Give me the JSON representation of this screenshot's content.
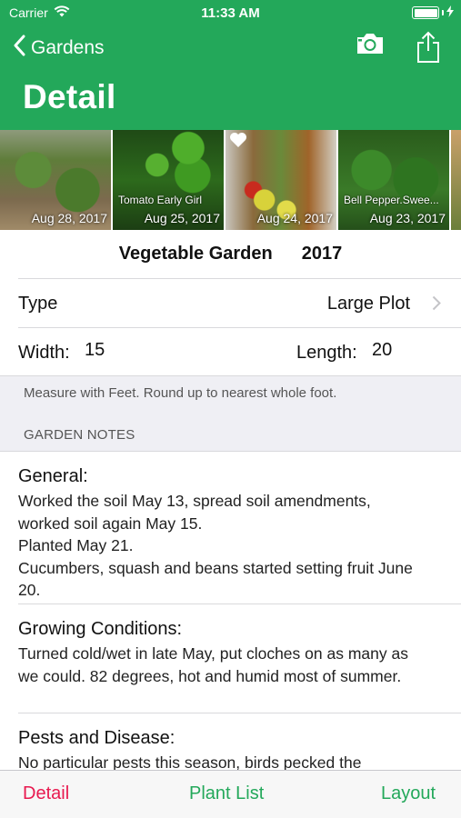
{
  "status": {
    "carrier": "Carrier",
    "time": "11:33 AM"
  },
  "nav": {
    "back_label": "Gardens",
    "title": "Detail",
    "camera_icon": "camera-icon",
    "share_icon": "share-icon"
  },
  "photos": [
    {
      "caption": "",
      "date": "Aug 28, 2017"
    },
    {
      "caption": "Tomato Early Girl",
      "date": "Aug 25, 2017"
    },
    {
      "caption": "",
      "date": "Aug 24, 2017",
      "favorite": true
    },
    {
      "caption": "Bell Pepper.Swee...",
      "date": "Aug 23, 2017"
    }
  ],
  "garden": {
    "name": "Vegetable Garden",
    "year": "2017"
  },
  "type": {
    "label": "Type",
    "value": "Large Plot"
  },
  "dimensions": {
    "width_label": "Width:",
    "width_value": "15",
    "length_label": "Length:",
    "length_value": "20"
  },
  "hint": "Measure with Feet. Round up to nearest whole foot.",
  "notes_header": "GARDEN NOTES",
  "notes": [
    {
      "title": "General:",
      "body": "Worked the soil May 13, spread soil amendments,\nworked soil again May 15.\nPlanted May 21.\nCucumbers, squash and beans started setting fruit June\n20."
    },
    {
      "title": "Growing Conditions:",
      "body": "Turned cold/wet in late May, put cloches on as many as\nwe could. 82 degrees, hot and humid most of summer."
    },
    {
      "title": "Pests and Disease:",
      "body": "No particular pests this season, birds pecked the"
    }
  ],
  "tabs": [
    {
      "label": "Detail",
      "active": true
    },
    {
      "label": "Plant List",
      "active": false
    },
    {
      "label": "Layout",
      "active": false
    }
  ],
  "colors": {
    "brand_green": "#23a85a",
    "active_tab": "#e8194f",
    "tab_green": "#23a85a"
  }
}
